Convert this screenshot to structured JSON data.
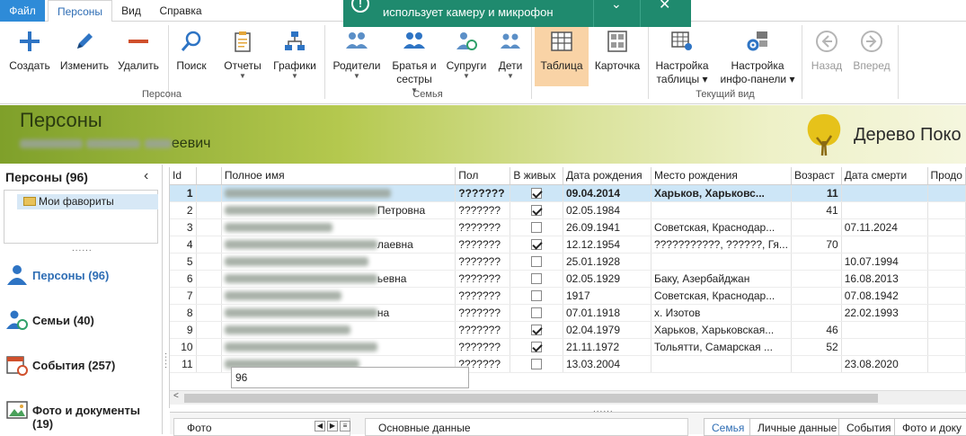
{
  "ribbon_tabs": {
    "file": "Файл",
    "persons": "Персоны",
    "view": "Вид",
    "help": "Справка"
  },
  "toast": {
    "message": "использует камеру и микрофон",
    "icon": "exclamation-icon"
  },
  "ribbon": {
    "create": "Создать",
    "edit": "Изменить",
    "delete": "Удалить",
    "search": "Поиск",
    "reports": "Отчеты",
    "graphs": "Графики",
    "parents": "Родители",
    "siblings_1": "Братья и",
    "siblings_2": "сестры",
    "spouses": "Супруги",
    "children": "Дети",
    "table": "Таблица",
    "card": "Карточка",
    "table_settings_1": "Настройка",
    "table_settings_2": "таблицы",
    "infopanel_settings_1": "Настройка",
    "infopanel_settings_2": "инфо-панели",
    "back": "Назад",
    "forward": "Вперед",
    "group_person": "Персона",
    "group_family": "Семья",
    "group_view": "Текущий вид"
  },
  "banner": {
    "title": "Персоны",
    "subtitle_visible": "еевич",
    "app_title": "Дерево Поко"
  },
  "sidebar": {
    "header": "Персоны (96)",
    "favorites": "Мои фавориты",
    "items": [
      {
        "label": "Персоны (96)",
        "icon": "person-icon"
      },
      {
        "label": "Семьи (40)",
        "icon": "family-icon"
      },
      {
        "label": "События (257)",
        "icon": "calendar-icon"
      },
      {
        "label": "Фото и документы (19)",
        "icon": "photo-icon"
      }
    ]
  },
  "grid": {
    "columns": [
      "Id",
      "",
      "Полное имя",
      "Пол",
      "В живых",
      "Дата рождения",
      "Место рождения",
      "Возраст",
      "Дата смерти",
      "Продо"
    ],
    "rows": [
      {
        "id": "1",
        "name_suffix": "",
        "sex": "???????",
        "alive": true,
        "birth": "09.04.2014",
        "place": "Харьков, Харьковс...",
        "age": "11",
        "death": ""
      },
      {
        "id": "2",
        "name_suffix": "Петровна",
        "sex": "???????",
        "alive": true,
        "birth": "02.05.1984",
        "place": "",
        "age": "41",
        "death": ""
      },
      {
        "id": "3",
        "name_suffix": "",
        "sex": "???????",
        "alive": false,
        "birth": "26.09.1941",
        "place": "Советская, Краснодар...",
        "age": "",
        "death": "07.11.2024"
      },
      {
        "id": "4",
        "name_suffix": "лаевна",
        "sex": "???????",
        "alive": true,
        "birth": "12.12.1954",
        "place": "???????????, ??????, Гя...",
        "age": "70",
        "death": ""
      },
      {
        "id": "5",
        "name_suffix": "",
        "sex": "???????",
        "alive": false,
        "birth": "25.01.1928",
        "place": "",
        "age": "",
        "death": "10.07.1994"
      },
      {
        "id": "6",
        "name_suffix": "ьевна",
        "sex": "???????",
        "alive": false,
        "birth": "02.05.1929",
        "place": "Баку, Азербайджан",
        "age": "",
        "death": "16.08.2013"
      },
      {
        "id": "7",
        "name_suffix": "",
        "sex": "???????",
        "alive": false,
        "birth": "1917",
        "place": "Советская, Краснодар...",
        "age": "",
        "death": "07.08.1942"
      },
      {
        "id": "8",
        "name_suffix": "на",
        "sex": "???????",
        "alive": false,
        "birth": "07.01.1918",
        "place": "х. Изотов",
        "age": "",
        "death": "22.02.1993"
      },
      {
        "id": "9",
        "name_suffix": "",
        "sex": "???????",
        "alive": true,
        "birth": "02.04.1979",
        "place": "Харьков, Харьковская...",
        "age": "46",
        "death": ""
      },
      {
        "id": "10",
        "name_suffix": "",
        "sex": "???????",
        "alive": true,
        "birth": "21.11.1972",
        "place": "Тольятти, Самарская ...",
        "age": "52",
        "death": ""
      },
      {
        "id": "11",
        "name_suffix": "",
        "sex": "???????",
        "alive": false,
        "birth": "13.03.2004",
        "place": "",
        "age": "",
        "death": "23.08.2020"
      }
    ],
    "filter_value": "96"
  },
  "bottom": {
    "photo": "Фото",
    "main_data": "Основные данные",
    "tabs": [
      "Семья",
      "Личные данные",
      "События",
      "Фото и доку"
    ]
  },
  "colors": {
    "accent": "#2e8bd8",
    "selected_view": "#f9d3a6",
    "selected_row": "#cde6f7",
    "toast": "#1f8a6e"
  }
}
